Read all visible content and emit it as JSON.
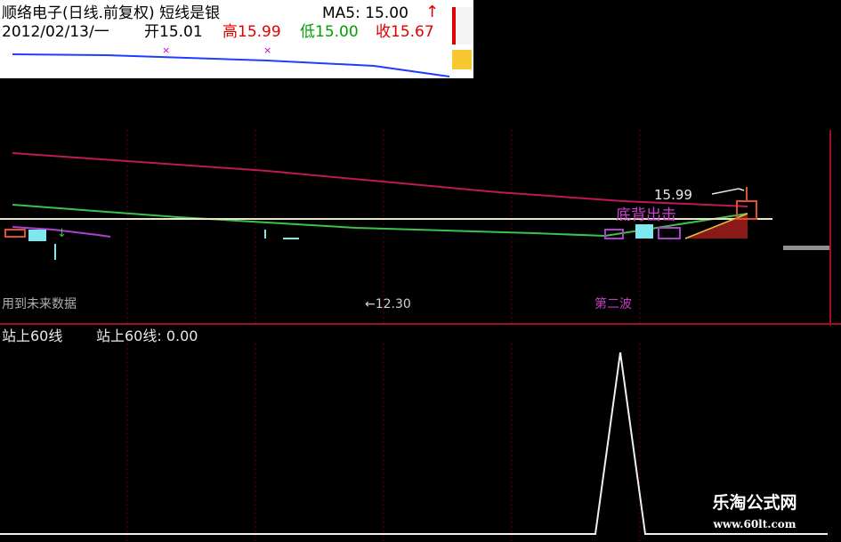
{
  "header": {
    "title": "顺络电子(日线.前复权) 短线是银",
    "ma5_label": "MA5: 15.00",
    "ma5_arrow": "↑",
    "date": "2012/02/13/一",
    "open_label": "开15.01",
    "high_label": "高15.99",
    "low_label": "低15.00",
    "close_label": "收15.67",
    "colors": {
      "high": "#e00000",
      "low": "#00a000",
      "close": "#e00000",
      "ma5_arrow": "#e00000"
    }
  },
  "main_chart": {
    "price_label": "15.99",
    "annotation_label": "底背出击",
    "bottom_left_label": "用到未来数据",
    "bottom_mid_label": "←12.30",
    "bottom_right_label": "第二波",
    "colors": {
      "line_upper": "#1f3cff",
      "line_red": "#c0185a",
      "line_green": "#3cc24a",
      "line_white": "#e8e8c8",
      "line_purple": "#b040d0",
      "annotation": "#d040d0"
    }
  },
  "indicator": {
    "title": "站上60线",
    "value_label": "站上60线: 0.00",
    "chart_data": {
      "type": "line",
      "series": [
        {
          "name": "站上60线",
          "values": [
            0,
            0,
            0,
            0,
            0,
            0,
            0,
            1,
            0,
            0,
            0
          ]
        }
      ],
      "ylim": [
        0,
        1
      ]
    }
  },
  "watermark": {
    "name": "乐淘公式网",
    "url": "www.60lt.com"
  }
}
